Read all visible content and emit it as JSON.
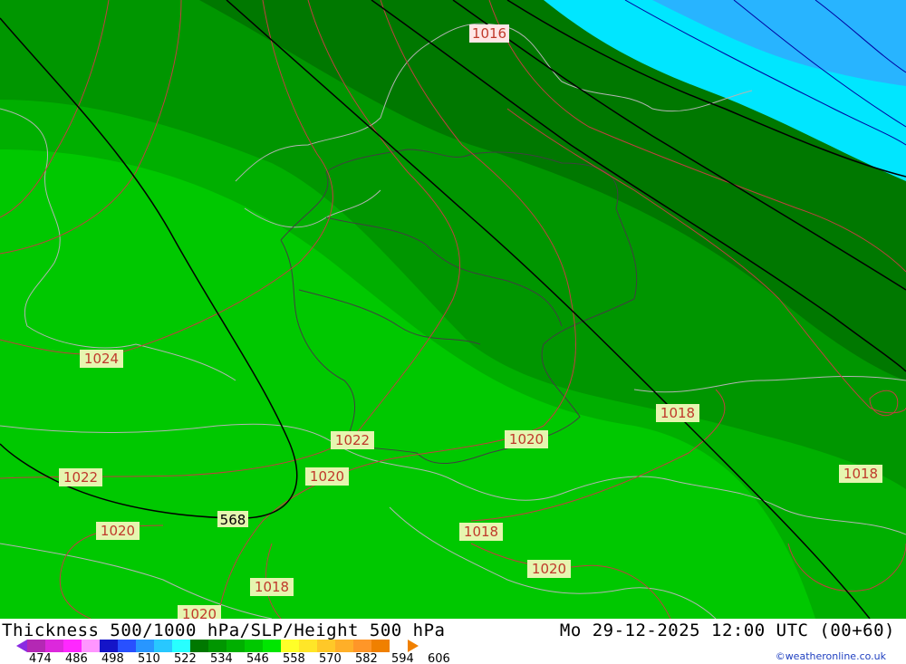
{
  "map": {
    "isobar_labels": [
      "1016",
      "1024",
      "1022",
      "1020",
      "1022",
      "1020",
      "1018",
      "1020",
      "1018",
      "1020",
      "1018",
      "1020",
      "1018",
      "1020"
    ],
    "height_label": "568",
    "colors": {
      "deep_green": "#007800",
      "dark_green": "#009600",
      "mid_green": "#00af00",
      "bright_green": "#00c800",
      "cyan": "#00e6ff",
      "sky_blue": "#28b4ff",
      "isobar": "#c04040",
      "height_contour": "#000000",
      "border": "#b4b4b4"
    }
  },
  "footer": {
    "title": "Thickness 500/1000 hPa/SLP/Height 500 hPa",
    "datetime": "Mo 29-12-2025 12:00 UTC (00+60)",
    "credit": "©weatheronline.co.uk",
    "scale_ticks": [
      "474",
      "486",
      "498",
      "510",
      "522",
      "534",
      "546",
      "558",
      "570",
      "582",
      "594",
      "606"
    ],
    "scale_colors": [
      "#b428b4",
      "#dc28dc",
      "#ff28ff",
      "#ff96ff",
      "#1414c8",
      "#2850ff",
      "#2896ff",
      "#28c8ff",
      "#28ffff",
      "#007800",
      "#009600",
      "#00af00",
      "#00c800",
      "#00e600",
      "#ffff28",
      "#ffe628",
      "#ffc828",
      "#ffaf28",
      "#ff9628",
      "#f08000"
    ]
  }
}
